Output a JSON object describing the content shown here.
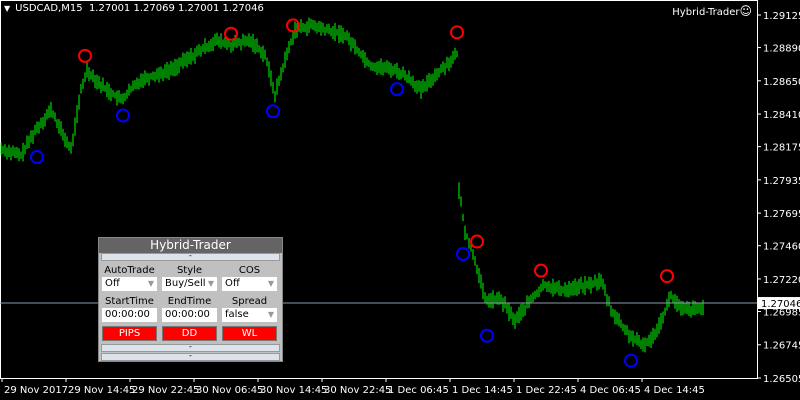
{
  "header": {
    "symbol": "USDCAD,M15",
    "ohlc": "1.27001 1.27069 1.27001 1.27046",
    "brand": "Hybrid-Trader",
    "smiley": "☺"
  },
  "colors": {
    "bars": "#00ff00",
    "high_marker": "#ff0000",
    "low_marker": "#0000ff",
    "bid_line": "#8a9aaa"
  },
  "chart_data": {
    "type": "line",
    "title": "USDCAD,M15",
    "ylim": [
      1.26505,
      1.29125
    ],
    "y_ticks": [
      "1.29125",
      "1.28890",
      "1.28650",
      "1.28410",
      "1.28175",
      "1.27935",
      "1.27695",
      "1.27460",
      "1.27220",
      "1.26985",
      "1.26745",
      "1.26505"
    ],
    "x_ticks": [
      "29 Nov 2017",
      "29 Nov 14:45",
      "29 Nov 22:45",
      "30 Nov 06:45",
      "30 Nov 14:45",
      "30 Nov 22:45",
      "1 Dec 06:45",
      "1 Dec 14:45",
      "1 Dec 22:45",
      "4 Dec 06:45",
      "4 Dec 14:45"
    ],
    "bars_per_tick": 32,
    "current_price": "1.27046",
    "path": [
      [
        0,
        1.2816
      ],
      [
        10,
        1.2811
      ],
      [
        17,
        1.2829
      ],
      [
        25,
        1.2844
      ],
      [
        30,
        1.2829
      ],
      [
        35,
        1.2815
      ],
      [
        40,
        1.2858
      ],
      [
        43,
        1.2873
      ],
      [
        50,
        1.2862
      ],
      [
        60,
        1.2851
      ],
      [
        70,
        1.2866
      ],
      [
        85,
        1.2873
      ],
      [
        100,
        1.2887
      ],
      [
        107,
        1.2894
      ],
      [
        115,
        1.2891
      ],
      [
        125,
        1.2894
      ],
      [
        132,
        1.2884
      ],
      [
        137,
        1.2855
      ],
      [
        142,
        1.288
      ],
      [
        147,
        1.2902
      ],
      [
        155,
        1.2905
      ],
      [
        162,
        1.2902
      ],
      [
        172,
        1.2898
      ],
      [
        185,
        1.2876
      ],
      [
        197,
        1.2873
      ],
      [
        205,
        1.2866
      ],
      [
        210,
        1.2858
      ],
      [
        217,
        1.2869
      ],
      [
        225,
        1.288
      ],
      [
        228,
        1.2884
      ],
      [
        229,
        1.2786
      ],
      [
        232,
        1.2757
      ],
      [
        237,
        1.2736
      ],
      [
        242,
        1.2707
      ],
      [
        250,
        1.2707
      ],
      [
        257,
        1.2692
      ],
      [
        265,
        1.2707
      ],
      [
        272,
        1.2718
      ],
      [
        280,
        1.2714
      ],
      [
        295,
        1.2718
      ],
      [
        300,
        1.2721
      ],
      [
        305,
        1.27
      ],
      [
        312,
        1.2685
      ],
      [
        320,
        1.2674
      ],
      [
        325,
        1.2678
      ],
      [
        330,
        1.2692
      ],
      [
        335,
        1.271
      ],
      [
        340,
        1.27
      ],
      [
        350,
        1.27
      ],
      [
        352,
        1.2705
      ]
    ],
    "high_markers": [
      [
        42,
        1.2883
      ],
      [
        115,
        1.2899
      ],
      [
        146,
        1.2905
      ],
      [
        228,
        1.29
      ],
      [
        238,
        1.2749
      ],
      [
        270,
        1.2728
      ],
      [
        333,
        1.2724
      ]
    ],
    "low_markers": [
      [
        18,
        1.281
      ],
      [
        61,
        1.284
      ],
      [
        136,
        1.2843
      ],
      [
        198,
        1.2859
      ],
      [
        231,
        1.274
      ],
      [
        243,
        1.2681
      ],
      [
        315,
        1.2663
      ]
    ]
  },
  "panel": {
    "title": "Hybrid-Trader",
    "collapse": "-",
    "fields": [
      {
        "label": "AutoTrade",
        "value": "Off"
      },
      {
        "label": "Style",
        "value": "Buy/Sell"
      },
      {
        "label": "COS",
        "value": "Off"
      }
    ],
    "fields2": [
      {
        "label": "StartTime",
        "value": "00:00:00"
      },
      {
        "label": "EndTime",
        "value": "00:00:00"
      },
      {
        "label": "Spread",
        "value": "false"
      }
    ],
    "buttons": [
      "PIPS",
      "DD",
      "WL"
    ],
    "arrow": "▼"
  }
}
